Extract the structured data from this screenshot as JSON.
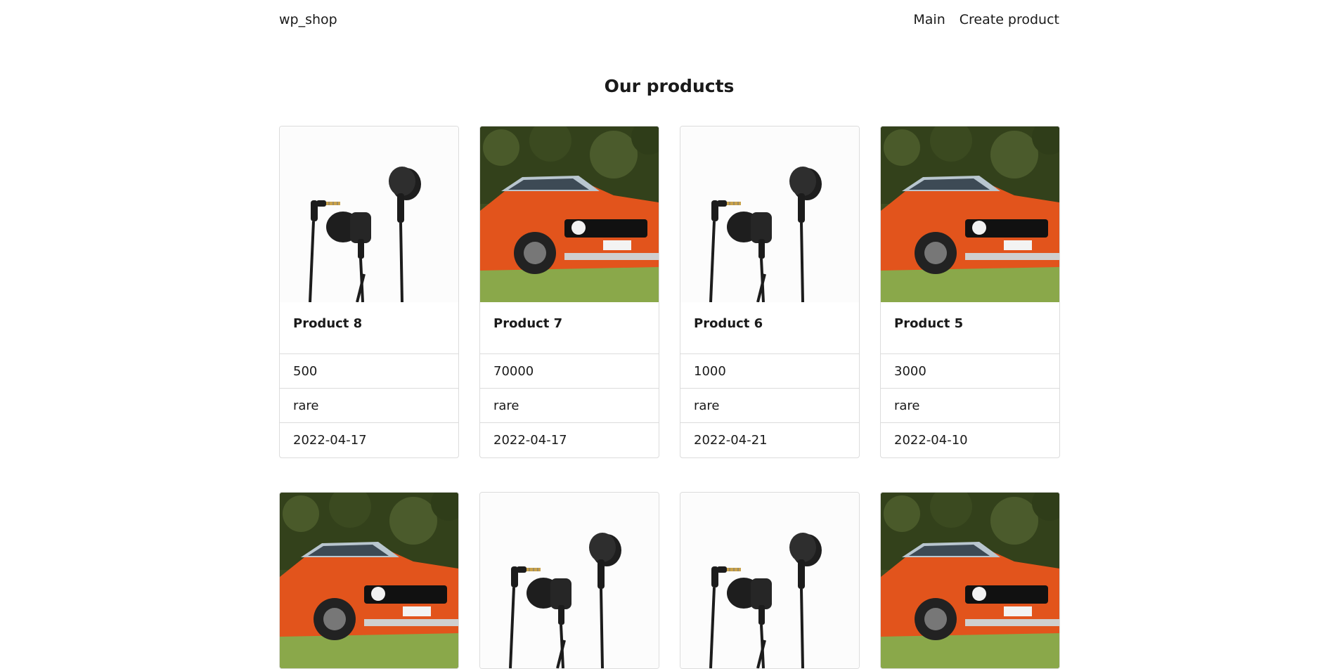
{
  "header": {
    "brand": "wp_shop",
    "nav": [
      {
        "label": "Main"
      },
      {
        "label": "Create product"
      }
    ]
  },
  "main": {
    "title": "Our products",
    "products": [
      {
        "name": "Product 8",
        "price": "500",
        "rarity": "rare",
        "date": "2022-04-17",
        "image": "earphones-image"
      },
      {
        "name": "Product 7",
        "price": "70000",
        "rarity": "rare",
        "date": "2022-04-17",
        "image": "car-image"
      },
      {
        "name": "Product 6",
        "price": "1000",
        "rarity": "rare",
        "date": "2022-04-21",
        "image": "earphones-image"
      },
      {
        "name": "Product 5",
        "price": "3000",
        "rarity": "rare",
        "date": "2022-04-10",
        "image": "car-image"
      },
      {
        "image": "car-image"
      },
      {
        "image": "earphones-image"
      },
      {
        "image": "earphones-image"
      },
      {
        "image": "car-image"
      }
    ]
  }
}
